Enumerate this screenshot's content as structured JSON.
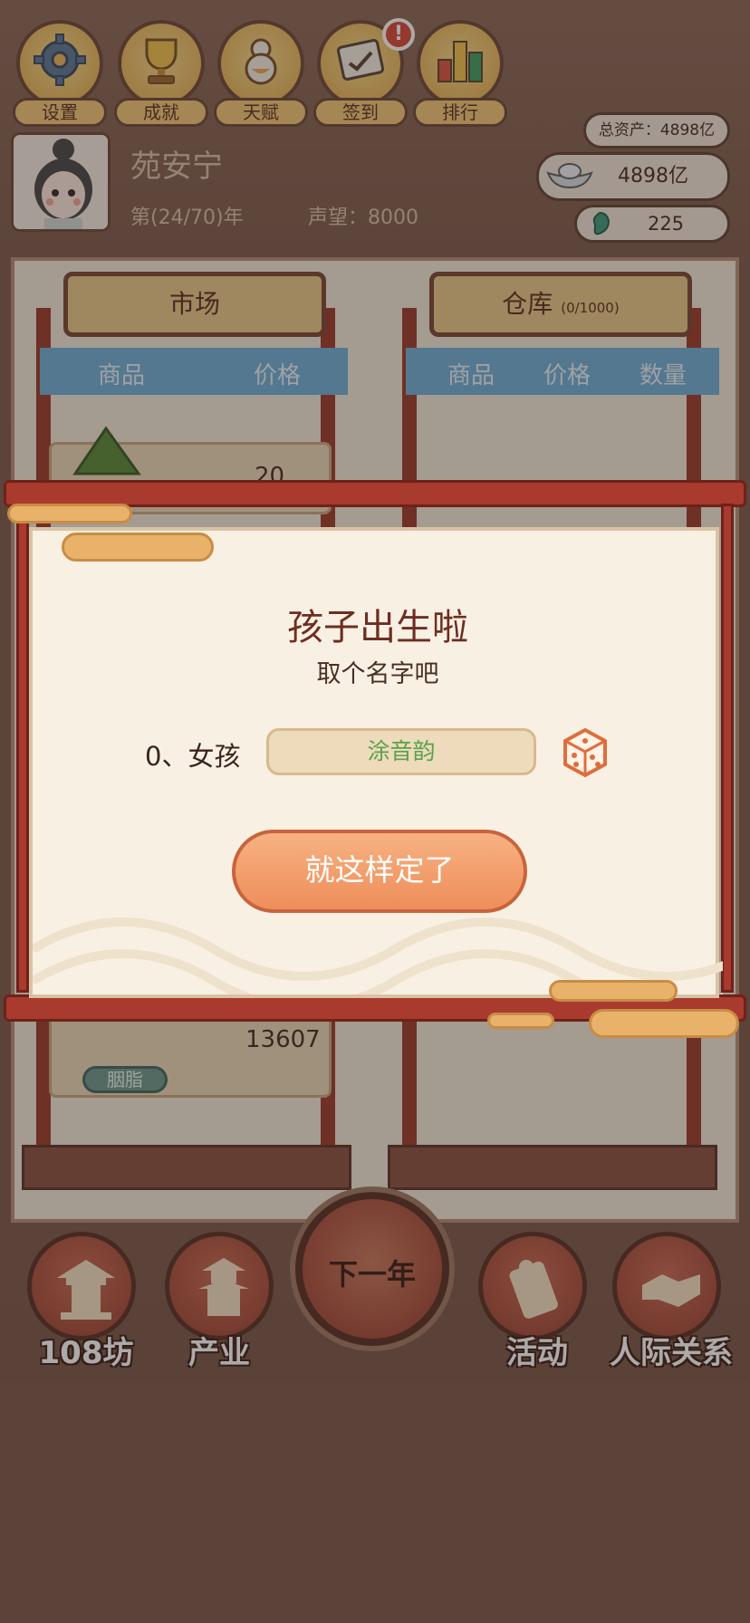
{
  "top_menu": [
    {
      "label": "设置",
      "icon": "gear-icon"
    },
    {
      "label": "成就",
      "icon": "trophy-icon"
    },
    {
      "label": "天赋",
      "icon": "gourd-icon"
    },
    {
      "label": "签到",
      "icon": "checkin-scroll-icon",
      "badge": "!"
    },
    {
      "label": "排行",
      "icon": "bar-ranking-icon"
    }
  ],
  "player": {
    "name": "苑安宁",
    "year": "第(24/70)年",
    "reputation": "声望：8000"
  },
  "assets": {
    "total": "总资产：4898亿",
    "silver": "4898亿",
    "jade": "225"
  },
  "market": {
    "title": "市场",
    "col_goods": "商品",
    "col_price": "价格",
    "visible_prices": [
      "20",
      "13607"
    ],
    "visible_tag": "胭脂"
  },
  "warehouse": {
    "title": "仓库",
    "capacity": "(0/1000)",
    "col_goods": "商品",
    "col_price": "价格",
    "col_qty": "数量"
  },
  "bottom_nav": {
    "workshops": "108坊",
    "industry": "产业",
    "next_year": "下一年",
    "activities": "活动",
    "relations": "人际关系"
  },
  "modal": {
    "title": "孩子出生啦",
    "subtitle": "取个名字吧",
    "child_label": "0、女孩",
    "child_name": "涂音韵",
    "confirm_label": "就这样定了"
  },
  "colors": {
    "accent_red": "#a83a2e",
    "confirm_orange": "#ee8e5a",
    "name_green": "#5aa14b"
  }
}
